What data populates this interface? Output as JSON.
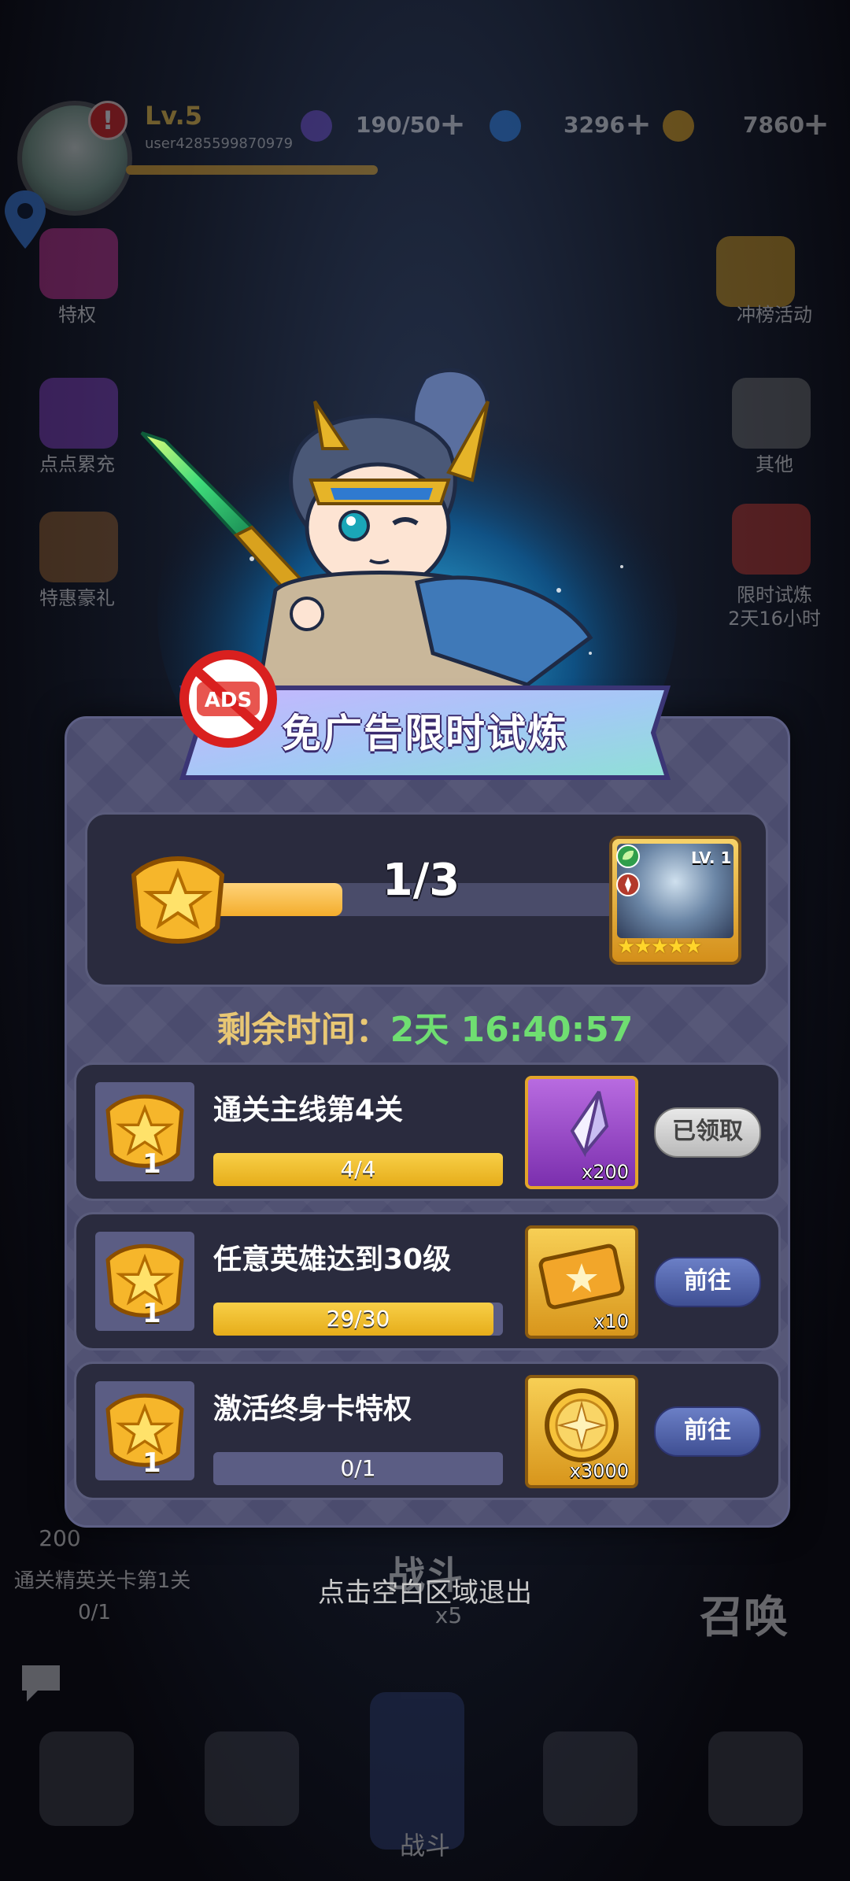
{
  "player": {
    "level": "Lv.5",
    "user_id": "user4285599870979"
  },
  "resources": {
    "stamina": "190/50",
    "gems": "3296",
    "gold": "7860"
  },
  "side_left": [
    "特权",
    "点点累充",
    "特惠豪礼"
  ],
  "side_right": [
    "冲榜活动",
    "其他",
    "限时试炼",
    "2天16小时"
  ],
  "bottom_text": {
    "count": "200",
    "elite_stage": "通关精英关卡第1关",
    "elite_progress": "0/1",
    "battle": "战斗",
    "summon": "召唤",
    "cost": "x5"
  },
  "nav": {
    "battle_label": "战斗"
  },
  "modal": {
    "title": "免广告限时试炼",
    "ads_badge": "ADS",
    "progress": {
      "text": "1/3",
      "current": 1,
      "total": 3
    },
    "reward_hero": {
      "level": "LV. 1",
      "stars": "★★★★★"
    },
    "remaining_label": "剩余时间：",
    "remaining_value": "2天 16:40:57",
    "tasks": [
      {
        "count": "1",
        "title": "通关主线第4关",
        "progress_text": "4/4",
        "current": 4,
        "total": 4,
        "reward_qty": "x200",
        "reward_color": "#9b4fc9",
        "button": "已领取",
        "button_state": "claimed"
      },
      {
        "count": "1",
        "title": "任意英雄达到30级",
        "progress_text": "29/30",
        "current": 29,
        "total": 30,
        "reward_qty": "x10",
        "reward_color": "#e3a52a",
        "button": "前往",
        "button_state": "go"
      },
      {
        "count": "1",
        "title": "激活终身卡特权",
        "progress_text": "0/1",
        "current": 0,
        "total": 1,
        "reward_qty": "x3000",
        "reward_color": "#e3a52a",
        "button": "前往",
        "button_state": "go"
      }
    ]
  },
  "exit_hint": "点击空白区域退出"
}
